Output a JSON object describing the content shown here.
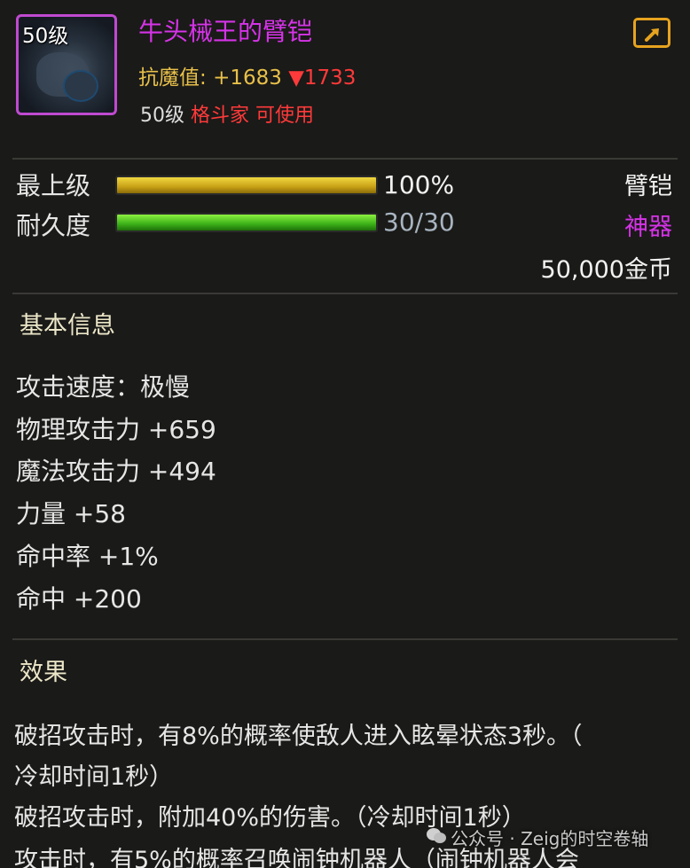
{
  "item": {
    "level_badge": "50级",
    "name": "牛头械王的臂铠",
    "resist_label": "抗魔值:",
    "resist_value": "+1683",
    "resist_down": "▼1733",
    "req_level": "50级",
    "req_class": "格斗家 可使用"
  },
  "bars": {
    "grade_label": "最上级",
    "grade_percent": "100%",
    "grade_fill": 1.0,
    "durability_label": "耐久度",
    "durability_value": "30/30",
    "durability_fill": 1.0
  },
  "meta": {
    "slot": "臂铠",
    "rarity": "神器",
    "price": "50,000金币",
    "rarity_color": "#d633e8",
    "title_color": "#d633e8"
  },
  "basic": {
    "title": "基本信息",
    "stats": [
      "攻击速度：极慢",
      "物理攻击力 +659",
      "魔法攻击力 +494",
      "力量 +58",
      "命中率 +1%",
      "命中 +200"
    ]
  },
  "effects": {
    "title": "效果",
    "lines": [
      "破招攻击时，有8%的概率使敌人进入眩晕状态3秒。（",
      "冷却时间1秒）",
      "破招攻击时，附加40%的伤害。（冷却时间1秒）",
      "攻击时，有5%的概率召唤闹钟机器人（闹钟机器人会"
    ]
  },
  "watermark": {
    "text": "公众号 · Zeig的时空卷轴",
    "icon": "wechat-icon"
  },
  "icons": {
    "share": "share-icon"
  }
}
